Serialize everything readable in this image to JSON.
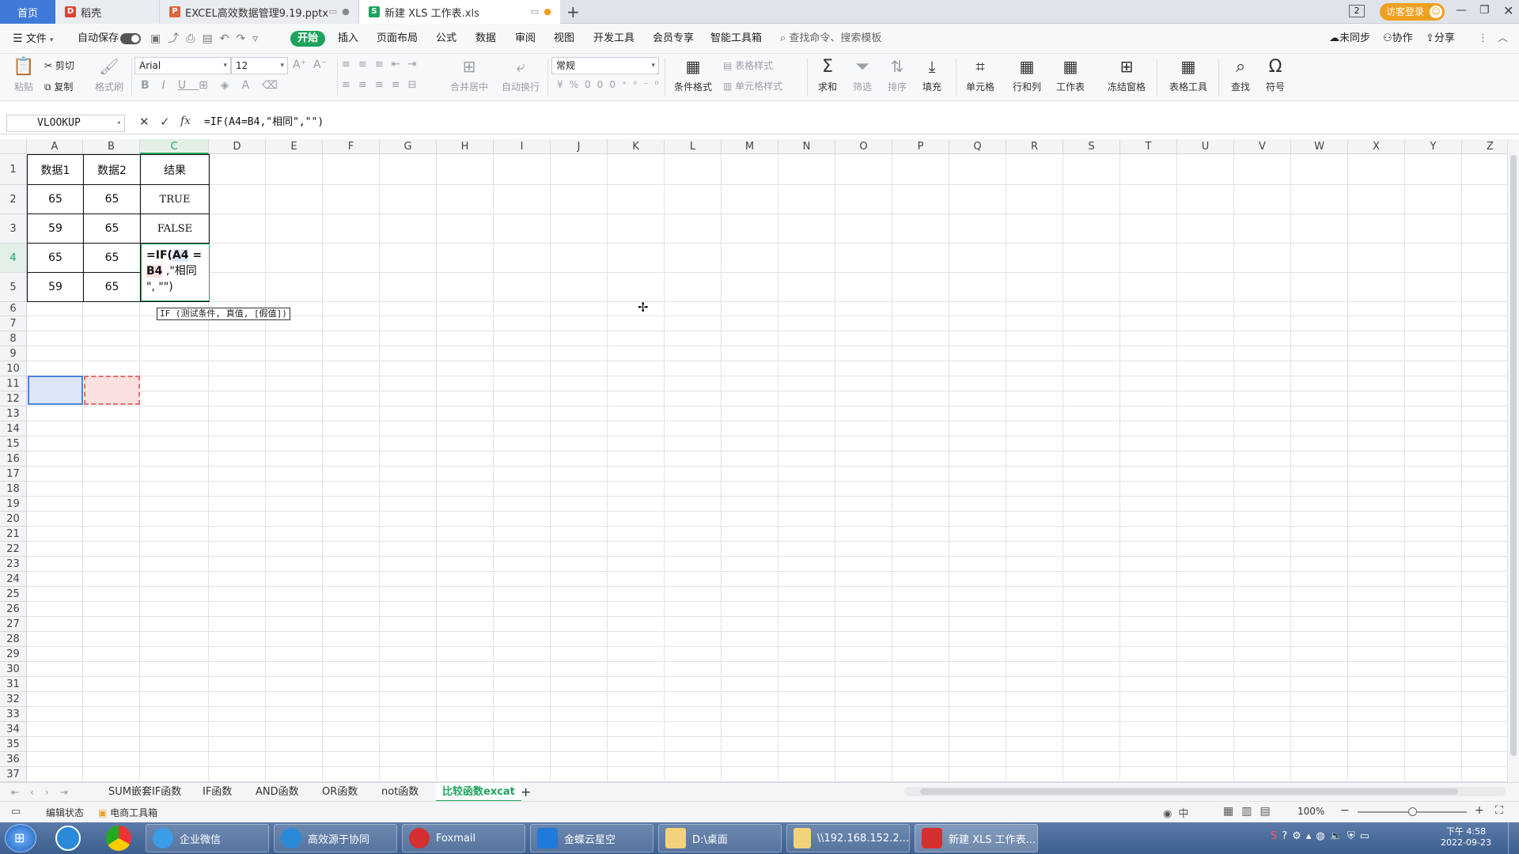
{
  "tabs": {
    "home": "首页",
    "daoke": "稻壳",
    "pptx": "EXCEL高效数据管理9.19.pptx",
    "xls": "新建 XLS 工作表.xls",
    "new_tab": "+"
  },
  "titlebar": {
    "login": "访客登录",
    "badge": "2"
  },
  "menu": {
    "file": "文件",
    "autosave": "自动保存",
    "start": "开始",
    "items": [
      "插入",
      "页面布局",
      "公式",
      "数据",
      "审阅",
      "视图",
      "开发工具",
      "会员专享",
      "智能工具箱"
    ],
    "search_placeholder": "查找命令、搜索模板",
    "unsynced": "未同步",
    "collab": "协作",
    "share": "分享"
  },
  "ribbon": {
    "paste": "粘贴",
    "cut": "剪切",
    "copy": "复制",
    "format_painter": "格式刷",
    "font_name": "Arial",
    "font_size": "12",
    "merge_center": "合并居中",
    "wrap": "自动换行",
    "number_format": "常规",
    "cond_format": "条件格式",
    "table_style": "表格样式",
    "cell_style": "单元格样式",
    "sum": "求和",
    "filter": "筛选",
    "sort": "排序",
    "fill": "填充",
    "cell": "单元格",
    "rowcol": "行和列",
    "worksheet": "工作表",
    "freeze": "冻结窗格",
    "table_tools": "表格工具",
    "find": "查找",
    "symbol": "符号"
  },
  "formula_bar": {
    "name_box": "VLOOKUP",
    "fx": "fx",
    "formula": "=IF(A4=B4,\"相同\",\"\")"
  },
  "sheet": {
    "columns": [
      "A",
      "B",
      "C",
      "D",
      "E",
      "F",
      "G",
      "H",
      "I",
      "J",
      "K",
      "L",
      "M",
      "N",
      "O",
      "P",
      "Q",
      "R",
      "S",
      "T",
      "U",
      "V",
      "W",
      "X",
      "Y",
      "Z"
    ],
    "rows": [
      "1",
      "2",
      "3",
      "4",
      "5",
      "6",
      "7",
      "8",
      "9",
      "10",
      "11",
      "12",
      "13",
      "14",
      "15",
      "16",
      "17",
      "18",
      "19",
      "20",
      "21",
      "22",
      "23",
      "24",
      "25",
      "26",
      "27",
      "28",
      "29",
      "30",
      "31",
      "32",
      "33",
      "34",
      "35",
      "36",
      "37"
    ],
    "header_row": [
      "数据1",
      "数据2",
      "结果"
    ],
    "data_rows": [
      [
        "65",
        "65",
        "TRUE"
      ],
      [
        "59",
        "65",
        "FALSE"
      ],
      [
        "65",
        "65",
        ""
      ],
      [
        "59",
        "65",
        ""
      ]
    ],
    "edit_cell_text": {
      "prefix": "=IF(",
      "ref1": "A4",
      "eq": " =",
      "ref2": "B4",
      "rest1": " ,\"相同",
      "rest2": "\",  \"\")"
    },
    "tooltip": "IF (测试条件, 真值, [假值])"
  },
  "sheet_tabs": {
    "list": [
      "SUM嵌套IF函数",
      "IF函数",
      "AND函数",
      "OR函数",
      "not函数",
      "比较函数excat"
    ],
    "active_index": 5,
    "add": "+"
  },
  "status": {
    "mode": "编辑状态",
    "toolbox": "电商工具箱",
    "zoom": "100%"
  },
  "taskbar": {
    "items": [
      "企业微信",
      "高效源于协同",
      "Foxmail",
      "金蝶云星空",
      "D:\\桌面",
      "\\\\192.168.152.2...",
      "新建 XLS 工作表..."
    ],
    "time": "下午 4:58",
    "date": "2022-09-23"
  },
  "colors": {
    "accent_green": "#1ea35c",
    "home_tab_blue": "#3f7ad8",
    "login_orange": "#f0a020",
    "a4_highlight": "#dbe7f7",
    "b4_highlight": "#fbe0e0"
  }
}
